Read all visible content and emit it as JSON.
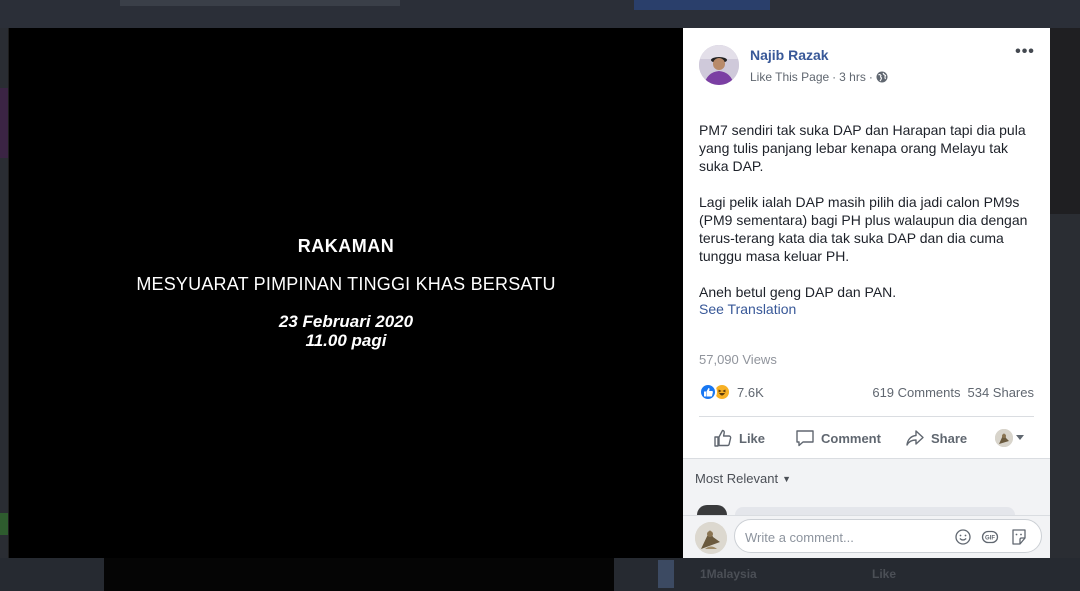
{
  "background": {
    "bottom_name": "1Malaysia",
    "bottom_like": "Like"
  },
  "video": {
    "title": "RAKAMAN",
    "subtitle": "MESYUARAT PIMPINAN TINGGI KHAS BERSATU",
    "date": "23 Februari 2020",
    "time": "11.00 pagi"
  },
  "post": {
    "author": "Najib Razak",
    "like_page": "Like This Page",
    "separator": "·",
    "time_ago": "3 hrs",
    "more_label": "•••",
    "paragraphs": [
      "PM7 sendiri tak suka DAP dan Harapan tapi dia pula yang tulis panjang lebar kenapa orang Melayu tak suka DAP.",
      "Lagi pelik ialah DAP masih pilih dia jadi calon PM9s (PM9 sementara) bagi PH plus walaupun dia dengan terus-terang kata dia tak suka DAP dan dia cuma tunggu masa keluar PH.",
      "Aneh betul geng DAP dan PAN."
    ],
    "see_translation": "See Translation",
    "views": "57,090 Views",
    "reaction_count": "7.6K",
    "comments_count": "619 Comments",
    "shares_count": "534 Shares",
    "actions": {
      "like": "Like",
      "comment": "Comment",
      "share": "Share"
    },
    "sort_label": "Most Relevant",
    "composer_placeholder": "Write a comment...",
    "colors": {
      "link": "#385898",
      "like_blue": "#1877f2",
      "haha_yellow": "#f7b125"
    }
  }
}
